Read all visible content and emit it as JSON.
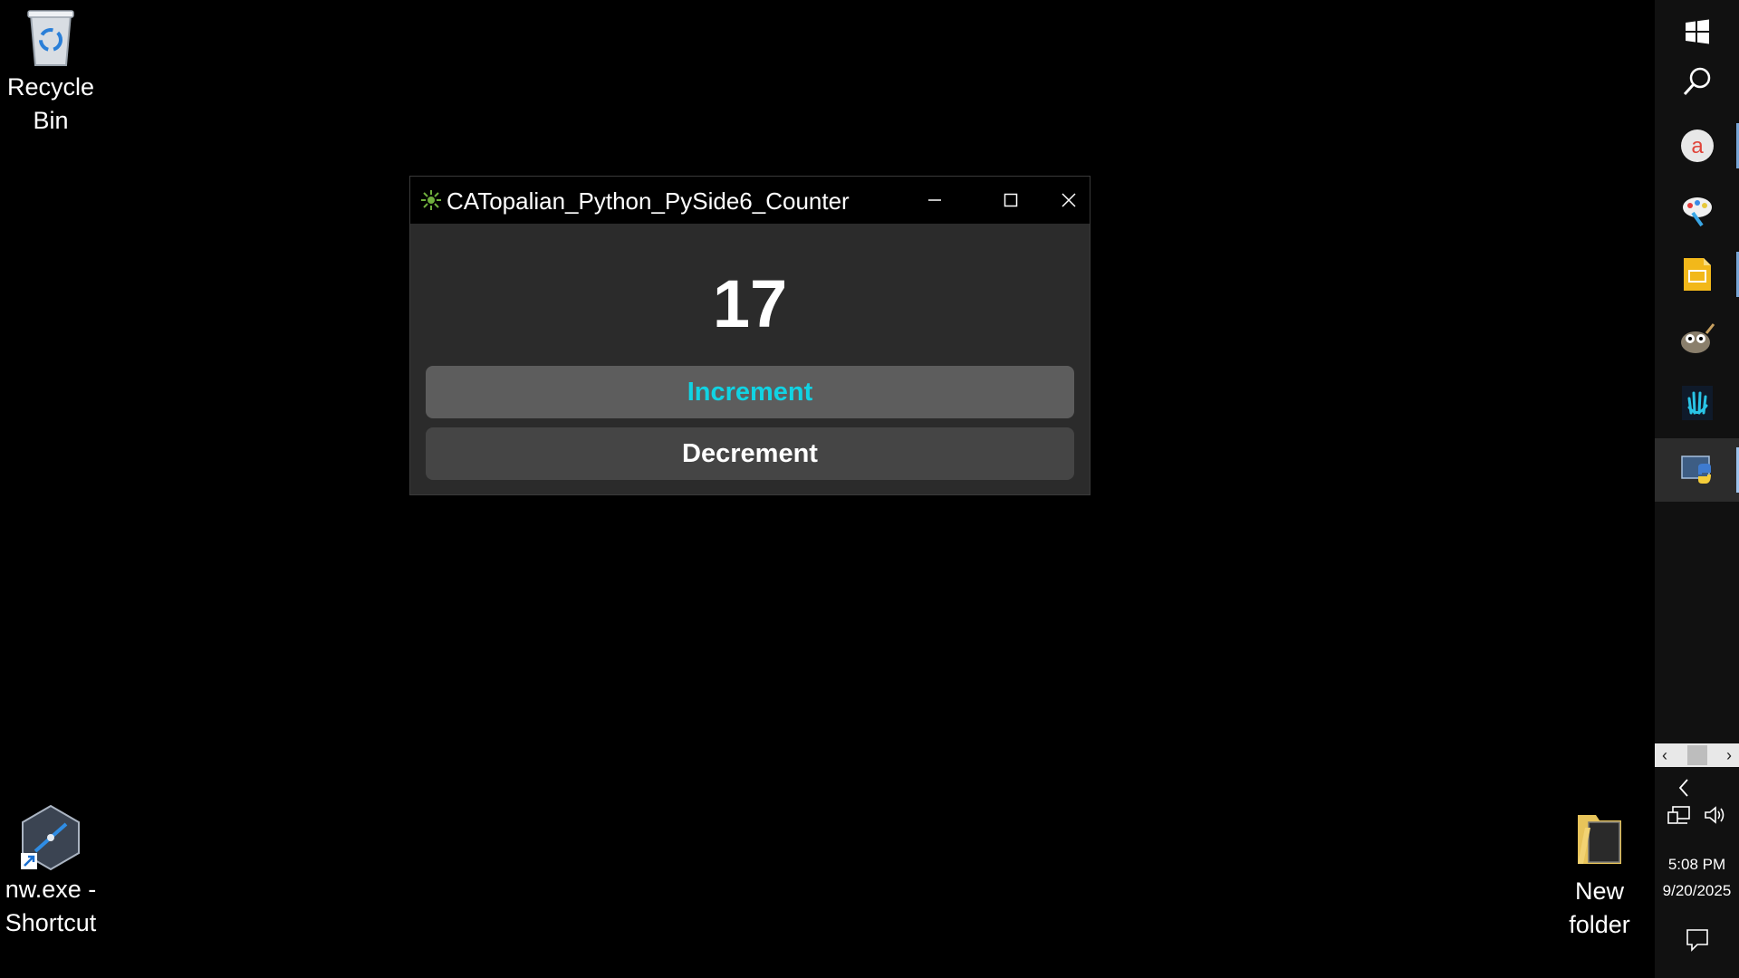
{
  "desktop": {
    "icons": [
      {
        "label": "Recycle Bin"
      },
      {
        "label": "nw.exe - Shortcut"
      },
      {
        "label": "New folder"
      }
    ]
  },
  "window": {
    "title": "CATopalian_Python_PySide6_Counter",
    "counter_value": "17",
    "increment_label": "Increment",
    "decrement_label": "Decrement",
    "accent": "#11d3e3"
  },
  "taskbar": {
    "time": "5:08 PM",
    "date": "9/20/2025",
    "pinned": [
      "start-icon",
      "search-icon",
      "app-a-icon",
      "paint-icon",
      "slides-icon",
      "gimp-icon",
      "hand-icon",
      "python-icon"
    ]
  }
}
